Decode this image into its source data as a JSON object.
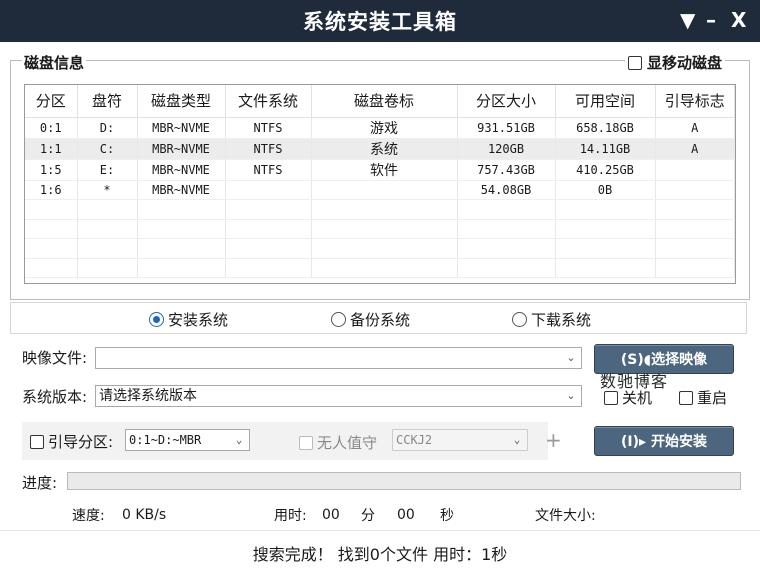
{
  "window": {
    "title": "系统安装工具箱",
    "menu_glyph": "▼",
    "minimize_glyph": "–",
    "close_glyph": "X"
  },
  "disk_info": {
    "label": "磁盘信息",
    "show_removable_label": "显移动磁盘",
    "show_removable_checked": false,
    "columns": [
      "分区",
      "盘符",
      "磁盘类型",
      "文件系统",
      "磁盘卷标",
      "分区大小",
      "可用空间",
      "引导标志"
    ],
    "rows": [
      [
        "0:1",
        "D:",
        "MBR~NVME",
        "NTFS",
        "游戏",
        "931.51GB",
        "658.18GB",
        "A"
      ],
      [
        "1:1",
        "C:",
        "MBR~NVME",
        "NTFS",
        "系统",
        "120GB",
        "14.11GB",
        "A"
      ],
      [
        "1:5",
        "E:",
        "MBR~NVME",
        "NTFS",
        "软件",
        "757.43GB",
        "410.25GB",
        ""
      ],
      [
        "1:6",
        "*",
        "MBR~NVME",
        "",
        "",
        "54.08GB",
        "0B",
        ""
      ]
    ],
    "selected_row": 1
  },
  "modes": {
    "install": "安装系统",
    "backup": "备份系统",
    "download": "下载系统",
    "selected": "install"
  },
  "image_file": {
    "label": "映像文件:",
    "value": "",
    "button_label": "(S)◖选择映像"
  },
  "system_version": {
    "label": "系统版本:",
    "value": "请选择系统版本",
    "shutdown_label": "关机",
    "shutdown_checked": false,
    "restart_label": "重启",
    "restart_checked": false
  },
  "watermark": "数驰博客",
  "boot": {
    "boot_partition_label": "引导分区:",
    "boot_partition_checked": false,
    "boot_partition_value": "0:1~D:~MBR",
    "unattended_label": "无人值守",
    "unattended_checked": false,
    "unattended_value": "CCKJ2",
    "plus_glyph": "+",
    "start_button_label": "(I)▸ 开始安装"
  },
  "progress": {
    "label": "进度:",
    "value": 0
  },
  "stats": {
    "speed_label": "速度:",
    "speed_value": "0 KB/s",
    "elapsed_label": "用时:",
    "minutes": "00",
    "min_unit": "分",
    "seconds": "00",
    "sec_unit": "秒",
    "filesize_label": "文件大小:"
  },
  "status_text": "搜索完成！ 找到0个文件 用时：1秒",
  "colors": {
    "titlebar": "#1f2a3a",
    "button": "#4d6680",
    "radio_accent": "#1e64c8"
  }
}
